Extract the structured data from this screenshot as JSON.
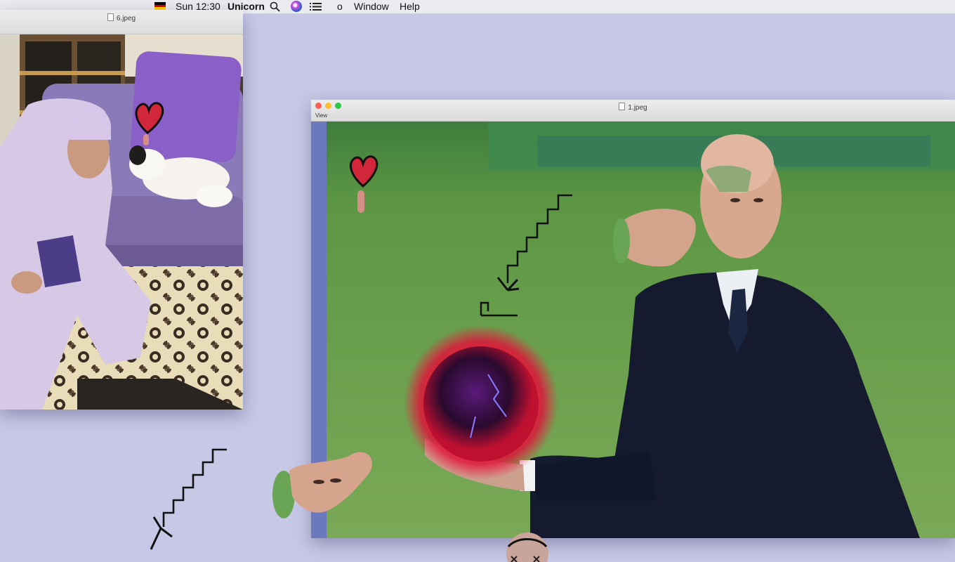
{
  "menubar": {
    "clock": "Sun 12:30",
    "app_name": "Unicorn",
    "item_o": "o",
    "window": "Window",
    "help": "Help",
    "flag_colors": [
      "#000000",
      "#dd0000",
      "#ffce00"
    ],
    "icons": [
      "flag-icon",
      "search-icon",
      "siri-icon",
      "list-icon"
    ]
  },
  "windows": {
    "six": {
      "title": "6.jpeg"
    },
    "one": {
      "title": "1.jpeg",
      "view_label": "View"
    }
  },
  "colors": {
    "desktop": "#c7c7e6",
    "close": "#fe5f57",
    "minimize": "#febc2e",
    "zoom": "#28c840"
  }
}
